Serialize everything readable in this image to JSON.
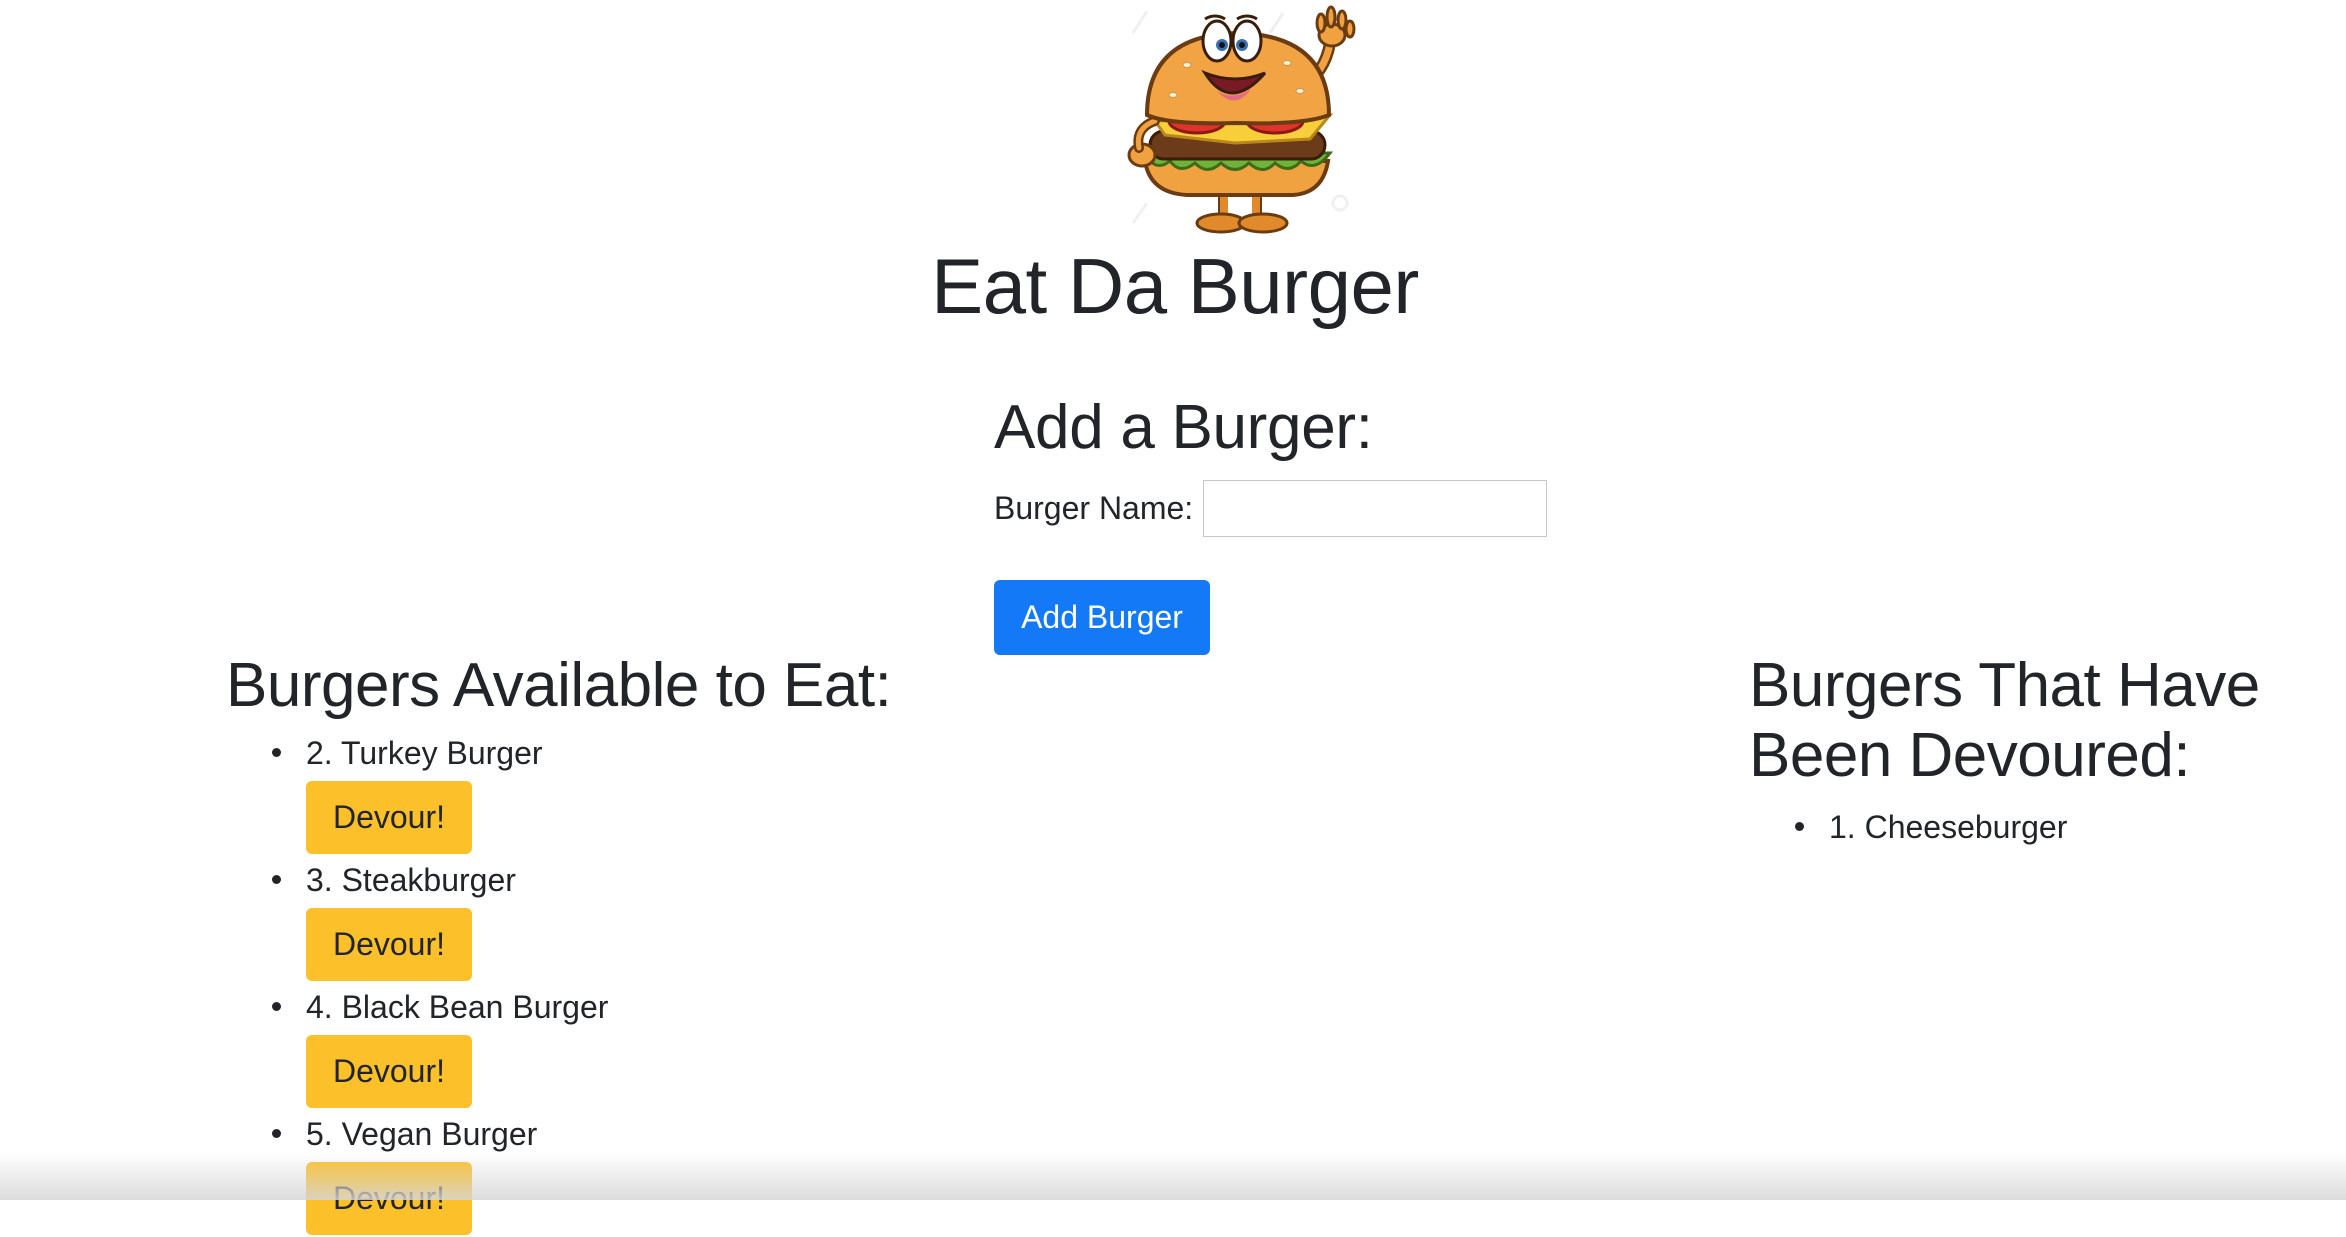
{
  "header": {
    "logo_icon": "waving-burger-mascot-icon",
    "title": "Eat Da Burger"
  },
  "add_form": {
    "heading": "Add a Burger:",
    "name_label": "Burger Name:",
    "name_value": "",
    "name_placeholder": "",
    "submit_label": "Add Burger"
  },
  "available": {
    "heading": "Burgers Available to Eat:",
    "devour_label": "Devour!",
    "items": [
      {
        "name": "2. Turkey Burger"
      },
      {
        "name": "3. Steakburger"
      },
      {
        "name": "4. Black Bean Burger"
      },
      {
        "name": "5. Vegan Burger"
      }
    ]
  },
  "devoured": {
    "heading": "Burgers That Have Been Devoured:",
    "items": [
      {
        "name": "1. Cheeseburger"
      }
    ]
  },
  "colors": {
    "primary_button": "#1479f6",
    "devour_button": "#fcc02b",
    "text": "#212529"
  }
}
